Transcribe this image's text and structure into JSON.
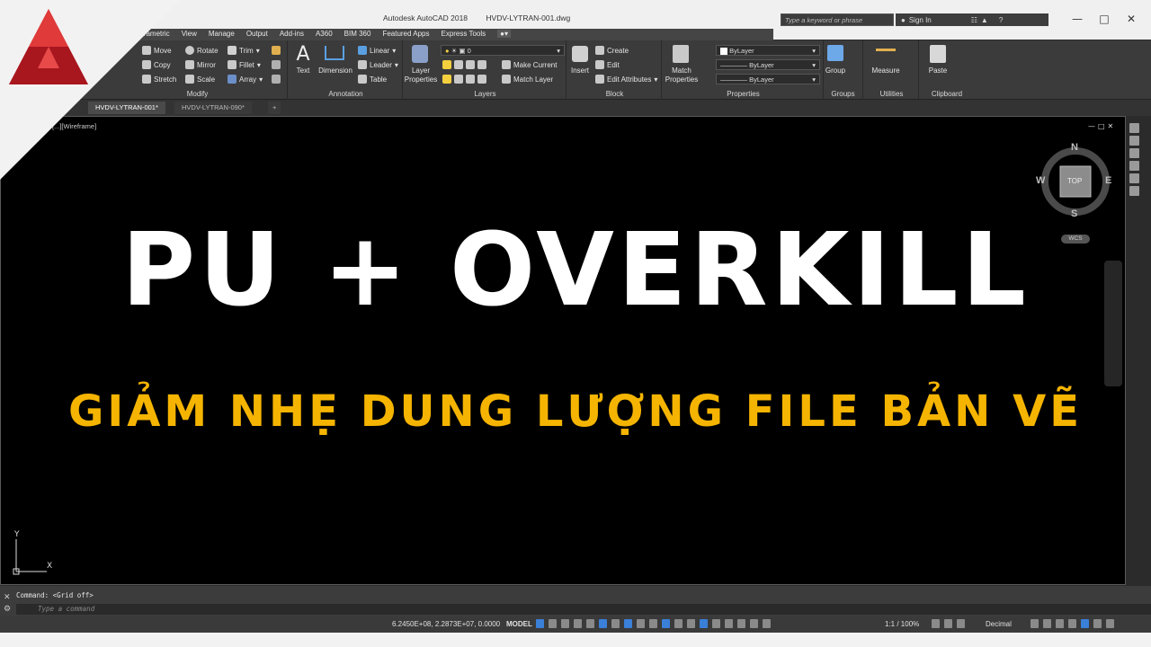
{
  "window": {
    "app_title": "Autodesk AutoCAD 2018",
    "file_title": "HVDV-LYTRAN-001.dwg",
    "search_placeholder": "Type a keyword or phrase",
    "sign_in": "Sign In"
  },
  "menu_tabs": [
    "Parametric",
    "View",
    "Manage",
    "Output",
    "Add-ins",
    "A360",
    "BIM 360",
    "Featured Apps",
    "Express Tools"
  ],
  "ribbon": {
    "modify": {
      "title": "Modify",
      "items": [
        "Move",
        "Rotate",
        "Trim",
        "Copy",
        "Mirror",
        "Fillet",
        "Stretch",
        "Scale",
        "Array"
      ]
    },
    "annotation": {
      "title": "Annotation",
      "text": "Text",
      "dimension": "Dimension",
      "linear": "Linear",
      "leader": "Leader",
      "table": "Table"
    },
    "layers": {
      "title": "Layers",
      "layer_properties_1": "Layer",
      "layer_properties_2": "Properties",
      "layer_value": "0",
      "make_current": "Make Current",
      "match_layer": "Match Layer"
    },
    "block": {
      "title": "Block",
      "insert": "Insert",
      "create": "Create",
      "edit": "Edit",
      "edit_attributes": "Edit Attributes"
    },
    "properties": {
      "title": "Properties",
      "match_1": "Match",
      "match_2": "Properties",
      "color": "ByLayer",
      "linetype": "ByLayer",
      "lineweight": "ByLayer"
    },
    "groups": {
      "title": "Groups",
      "group": "Group"
    },
    "utilities": {
      "title": "Utilities",
      "measure": "Measure"
    },
    "clipboard": {
      "title": "Clipboard",
      "paste": "Paste"
    }
  },
  "doc_tabs": [
    "HVDV-LYTRAN-001*",
    "HVDV-LYTRAN-090*"
  ],
  "viewport": {
    "label": "[...][Wireframe]",
    "headline": "PU + OVERKILL",
    "subheadline": "GIẢM NHẸ DUNG LƯỢNG FILE BẢN VẼ"
  },
  "viewcube": {
    "n": "N",
    "s": "S",
    "e": "E",
    "w": "W",
    "face": "TOP",
    "wcs": "WCS"
  },
  "ucs": {
    "x": "X",
    "y": "Y"
  },
  "command": {
    "history": "Command:  <Grid off>",
    "placeholder": "Type a command"
  },
  "status": {
    "coords": "6.2450E+08, 2.2873E+07, 0.0000",
    "model": "MODEL",
    "scale": "1:1 / 100%",
    "units": "Decimal"
  },
  "colors": {
    "accent_yellow": "#f5b400",
    "logo_red": "#c8202a"
  }
}
